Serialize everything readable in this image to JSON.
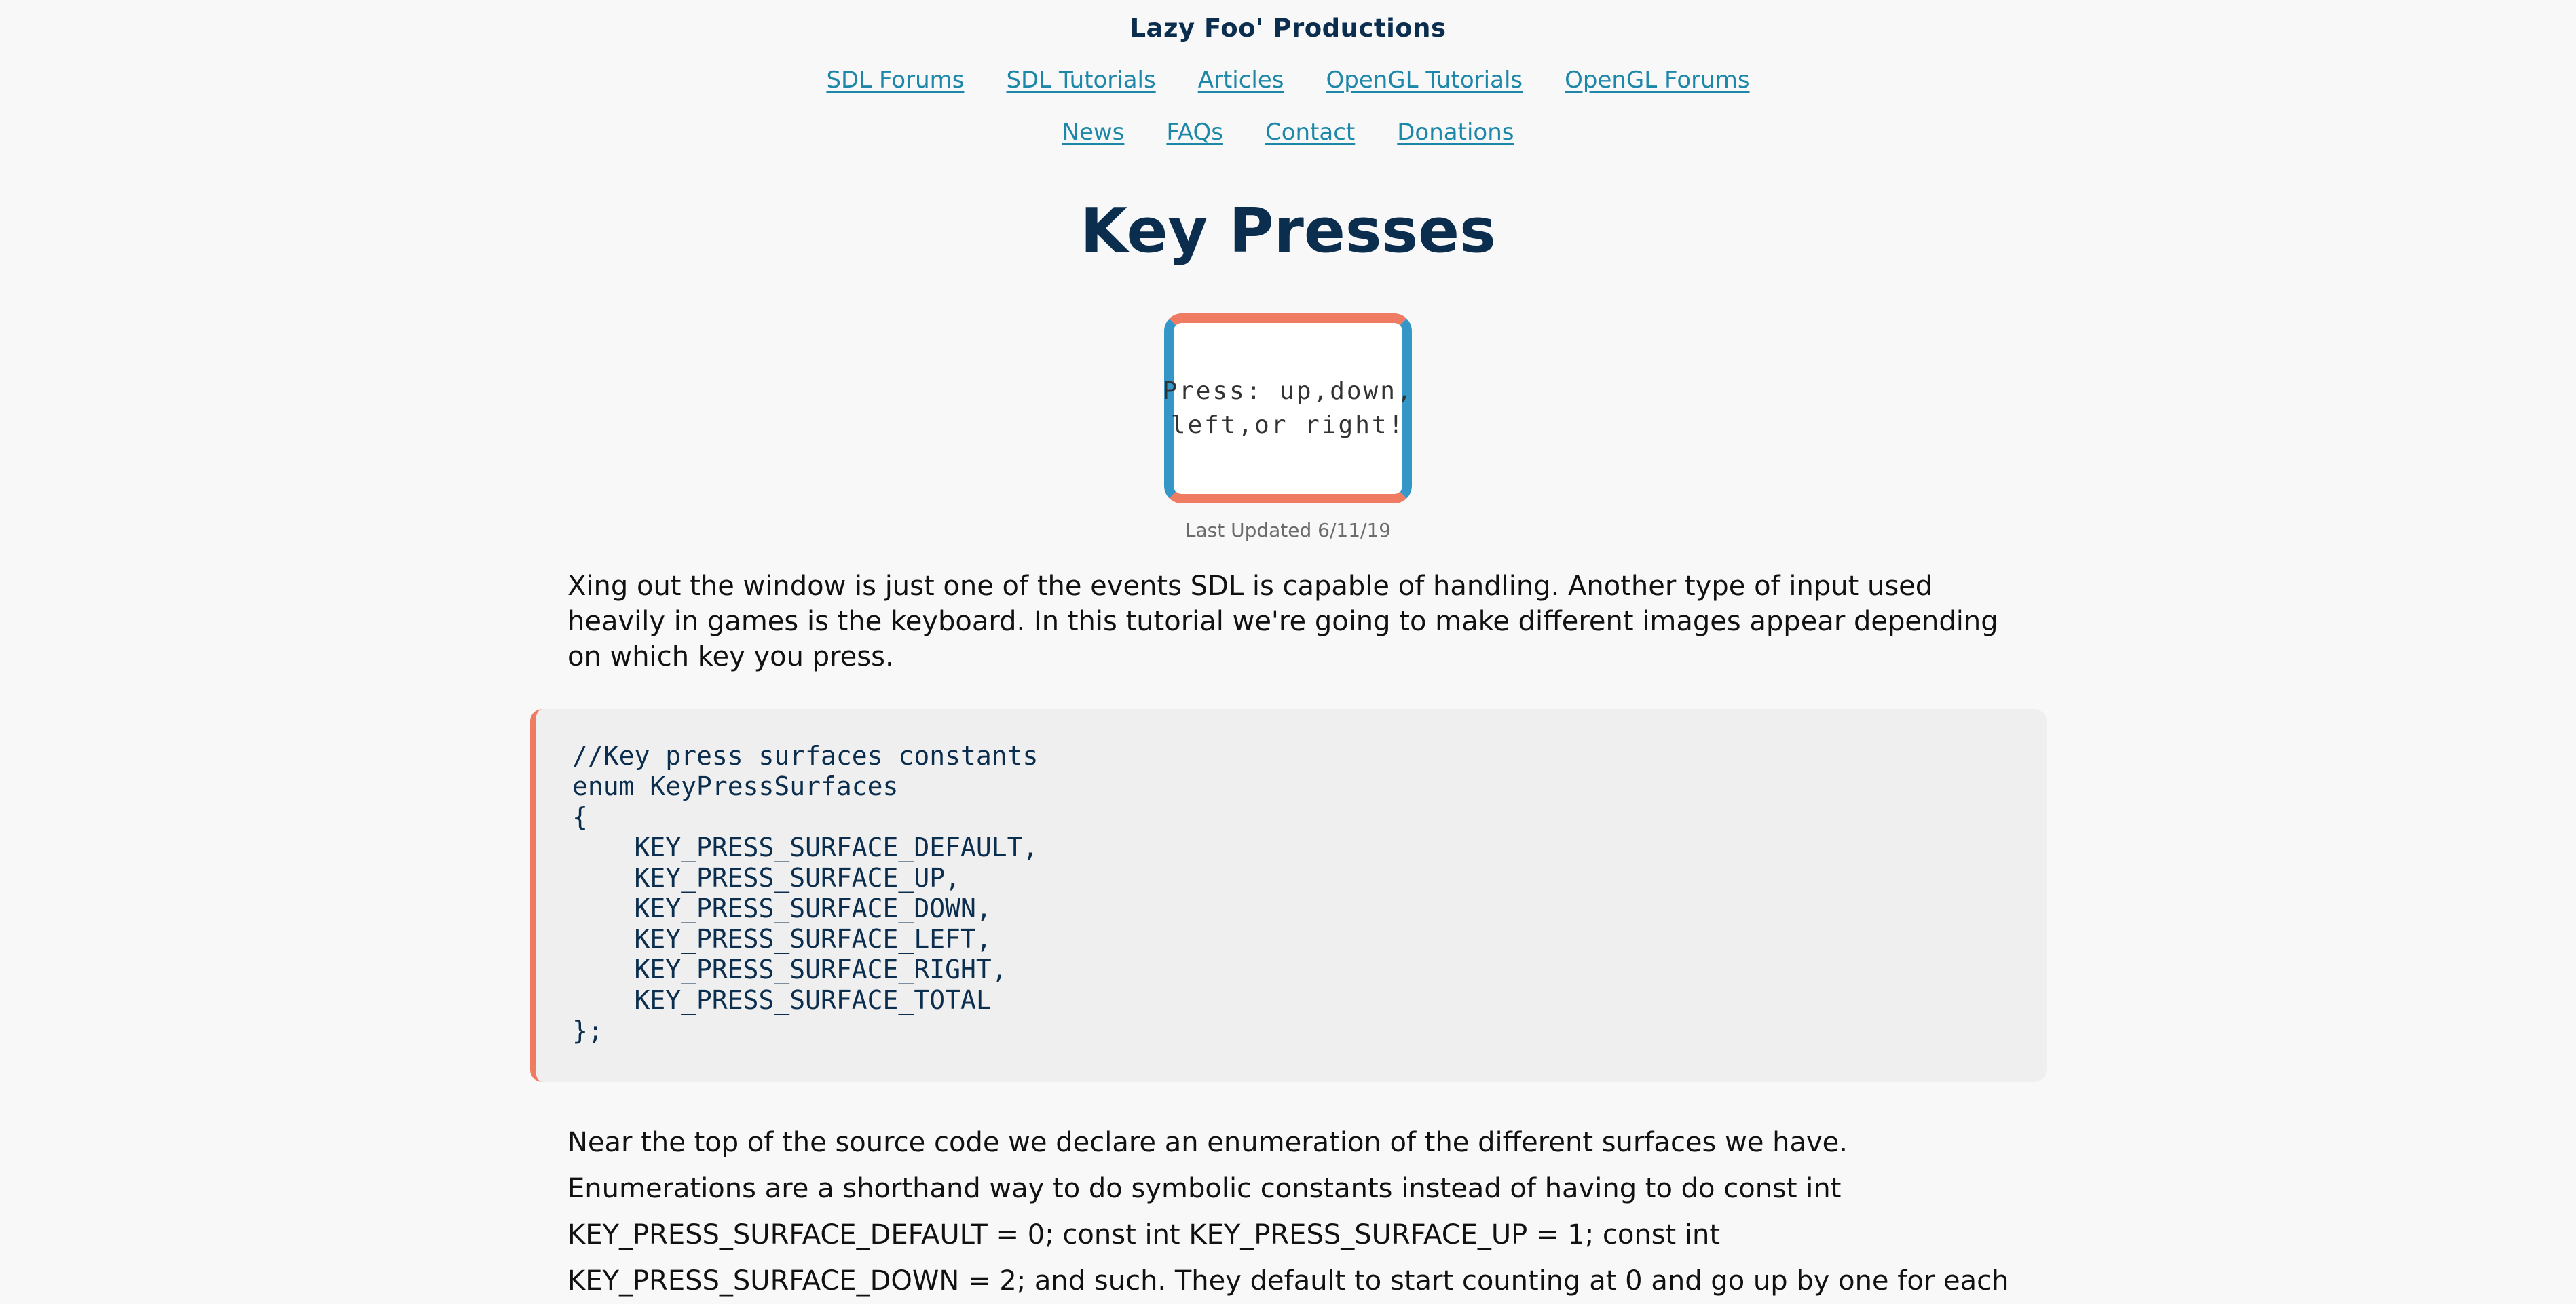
{
  "site": {
    "title": "Lazy Foo' Productions"
  },
  "nav": {
    "row1": [
      "SDL Forums",
      "SDL Tutorials",
      "Articles",
      "OpenGL Tutorials",
      "OpenGL Forums"
    ],
    "row2": [
      "News",
      "FAQs",
      "Contact",
      "Donations"
    ]
  },
  "page": {
    "title": "Key Presses",
    "preview_text": "Press: up,down,\nleft,or right!",
    "last_updated": "Last Updated 6/11/19"
  },
  "content": {
    "intro": "Xing out the window is just one of the events SDL is capable of handling. Another type of input used heavily in games is the keyboard. In this tutorial we're going to make different images appear depending on which key you press.",
    "code_lines": [
      "//Key press surfaces constants",
      "enum KeyPressSurfaces",
      "{",
      "    KEY_PRESS_SURFACE_DEFAULT,",
      "    KEY_PRESS_SURFACE_UP,",
      "    KEY_PRESS_SURFACE_DOWN,",
      "    KEY_PRESS_SURFACE_LEFT,",
      "    KEY_PRESS_SURFACE_RIGHT,",
      "    KEY_PRESS_SURFACE_TOTAL",
      "};"
    ],
    "explanation": "Near the top of the source code we declare an enumeration of the different surfaces we have. Enumerations are a shorthand way to do symbolic constants instead of having to do const int KEY_PRESS_SURFACE_DEFAULT = 0; const int KEY_PRESS_SURFACE_UP = 1; const int KEY_PRESS_SURFACE_DOWN = 2; and such. They default to start counting at 0 and go up by one for each"
  },
  "colors": {
    "accent_navy": "#0b2e4f",
    "link_blue": "#1c87a8",
    "frame_orange": "#ee7b62",
    "frame_blue": "#3597c8"
  }
}
